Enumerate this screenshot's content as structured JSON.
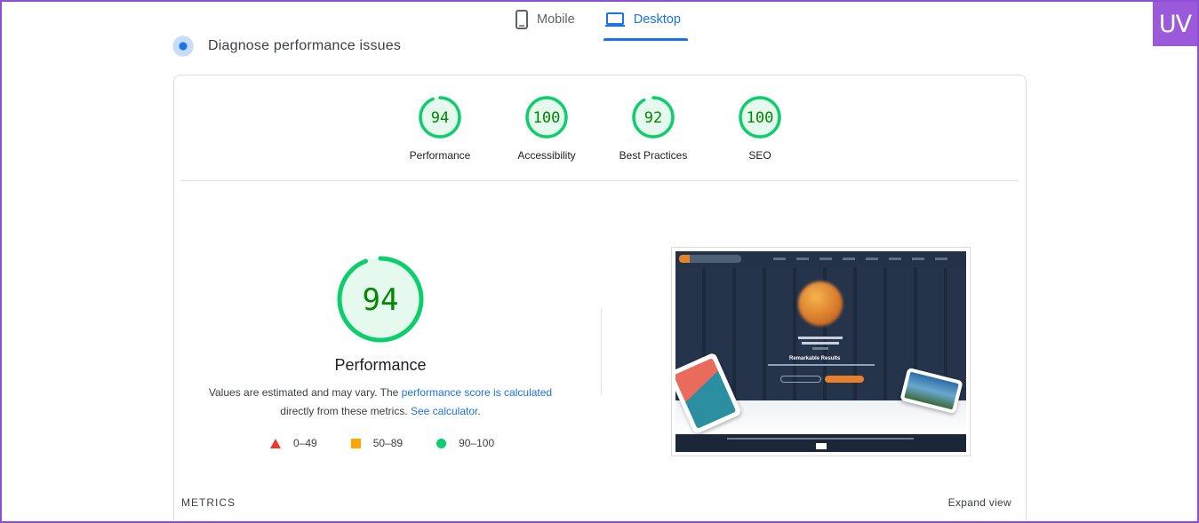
{
  "tabs": [
    {
      "label": "Mobile",
      "icon": "phone-icon",
      "active": false
    },
    {
      "label": "Desktop",
      "icon": "laptop-icon",
      "active": true
    }
  ],
  "badge": {
    "text": "UV",
    "color": "#9a5ad9"
  },
  "diagnose": {
    "title": "Diagnose performance issues"
  },
  "scores": [
    {
      "value": 94,
      "label": "Performance"
    },
    {
      "value": 100,
      "label": "Accessibility"
    },
    {
      "value": 92,
      "label": "Best Practices"
    },
    {
      "value": 100,
      "label": "SEO"
    }
  ],
  "main_score": {
    "value": 94,
    "title": "Performance",
    "desc_prefix": "Values are estimated and may vary. The ",
    "desc_link1": "performance score is calculated",
    "desc_middle": "directly from these metrics. ",
    "desc_link2": "See calculator",
    "desc_suffix": "."
  },
  "legend": [
    {
      "range": "0–49",
      "shape": "triangle",
      "color": "#eb3a2e"
    },
    {
      "range": "50–89",
      "shape": "square",
      "color": "#ffa400"
    },
    {
      "range": "90–100",
      "shape": "circle",
      "color": "#0cce6b"
    }
  ],
  "thumbnail": {
    "heading": "Remarkable Results"
  },
  "metrics": {
    "label": "METRICS",
    "expand": "Expand view"
  },
  "colors": {
    "pass": "#0cce6b",
    "pass_text": "#008800",
    "pass_bg": "#e6f9ee",
    "accent": "#1a73e8"
  }
}
